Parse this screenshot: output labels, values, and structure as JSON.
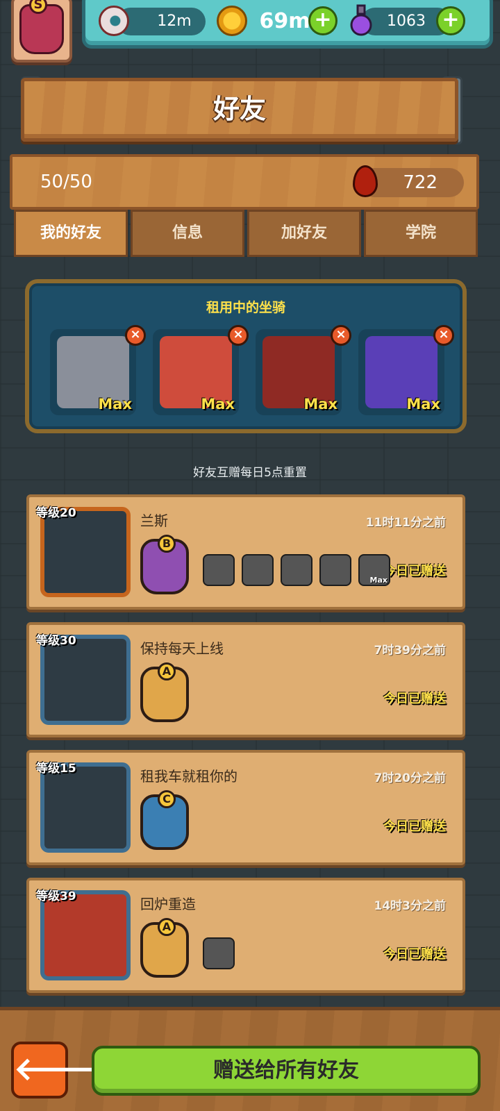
{
  "player": {
    "rank": "S"
  },
  "resources": {
    "eyes": "12m",
    "coins": "69m",
    "potions": "1063"
  },
  "page_title": "好友",
  "friend_count": "50/50",
  "blood_points": "722",
  "tabs": [
    "我的好友",
    "信息",
    "加好友",
    "学院"
  ],
  "mounts_panel": {
    "title": "租用中的坐骑",
    "mounts": [
      {
        "label": "Max",
        "color": "#8a8f9a"
      },
      {
        "label": "Max",
        "color": "#cf4c3c"
      },
      {
        "label": "Max",
        "color": "#8f2a24"
      },
      {
        "label": "Max",
        "color": "#5a3fb7"
      }
    ]
  },
  "reset_note": "好友互赠每日5点重置",
  "friends": [
    {
      "level": "等级20",
      "name": "兰斯",
      "time": "11时11分之前",
      "status": "今日已赠送",
      "grade": "B",
      "badge_color": "#8f4fb1",
      "frame": "#c6651d",
      "mini_mounts": [
        "",
        "",
        "",
        "",
        "Max"
      ]
    },
    {
      "level": "等级30",
      "name": "保持每天上线",
      "time": "7时39分之前",
      "status": "今日已赠送",
      "grade": "A",
      "badge_color": "#e0a64a",
      "frame": "#3f6e90",
      "mini_mounts": []
    },
    {
      "level": "等级15",
      "name": "租我车就租你的",
      "time": "7时20分之前",
      "status": "今日已赠送",
      "grade": "C",
      "badge_color": "#3b7fb3",
      "frame": "#3f6e90",
      "mini_mounts": []
    },
    {
      "level": "等级39",
      "name": "回炉重造",
      "time": "14时3分之前",
      "status": "今日已赠送",
      "grade": "A",
      "badge_color": "#e0a64a",
      "frame": "#3f6e90",
      "mini_mounts": [
        ""
      ]
    }
  ],
  "bottom": {
    "back_label": "🡐",
    "gift_all_label": "赠送给所有好友"
  }
}
